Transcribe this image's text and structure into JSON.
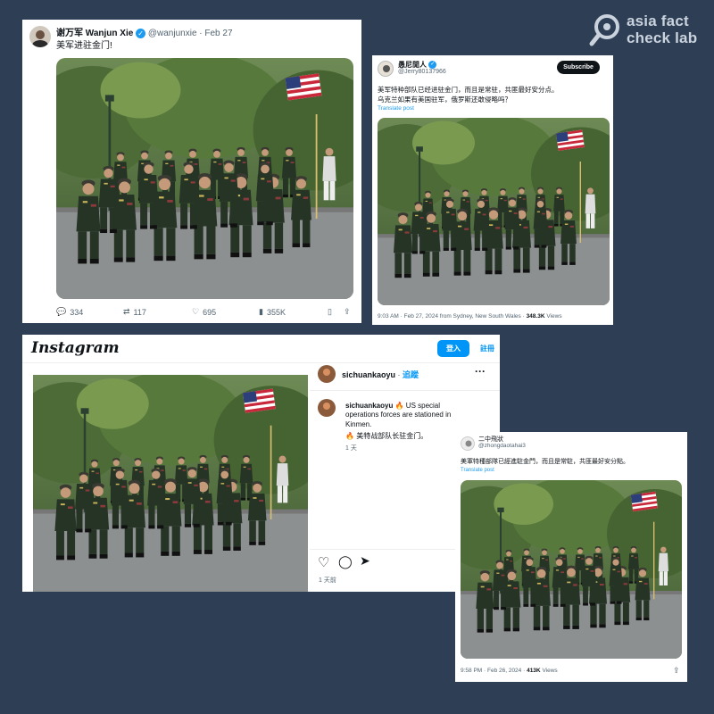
{
  "logo": {
    "line1": "asia fact",
    "line2": "check lab"
  },
  "post1": {
    "display_name": "谢万军 Wanjun Xie",
    "handle": "@wanjunxie",
    "date": "· Feb 27",
    "text": "美军进驻金门!",
    "replies": "334",
    "reposts": "117",
    "likes": "695",
    "views": "355K"
  },
  "post2": {
    "display_name": "愚尼閒人",
    "handle": "@Jerry80137966",
    "subscribe_label": "Subscribe",
    "text_line1": "美军特种部队已经进驻金门，而且是常驻，共匪最好安分点。",
    "text_line2": "乌克兰如果有美国驻军，俄罗斯还敢侵略吗？",
    "translate": "Translate post",
    "footer_time": "9:03 AM · Feb 27, 2024 from Sydney, New South Wales ·",
    "views_count": "348.3K",
    "views_label": "Views"
  },
  "instagram": {
    "brand": "Instagram",
    "login_label": "登入",
    "signup_label": "註冊",
    "username": "sichuankaoyu",
    "follow_label": "追蹤",
    "caption_user": "sichuankaoyu",
    "caption_line1": "US special",
    "caption_line2": "operations forces are stationed in",
    "caption_line3": "Kinmen.",
    "caption_line4": "美特战部队长驻金门。",
    "comment_age": "1 天",
    "post_age": "1 天前"
  },
  "post4": {
    "display_name": "二中飛狀",
    "handle": "@zhongdaotahai3",
    "text": "美軍特種部隊已經進駐金門，而且是常駐，共匪最好安分點。",
    "translate": "Translate post",
    "footer_time": "9:58 PM · Feb 26, 2024 ·",
    "views_count": "413K",
    "views_label": "Views"
  },
  "colors": {
    "background": "#2e3f55",
    "twitter_blue": "#1d9bf0",
    "instagram_blue": "#0095f6",
    "uniform_green": "#2a3a2a"
  }
}
